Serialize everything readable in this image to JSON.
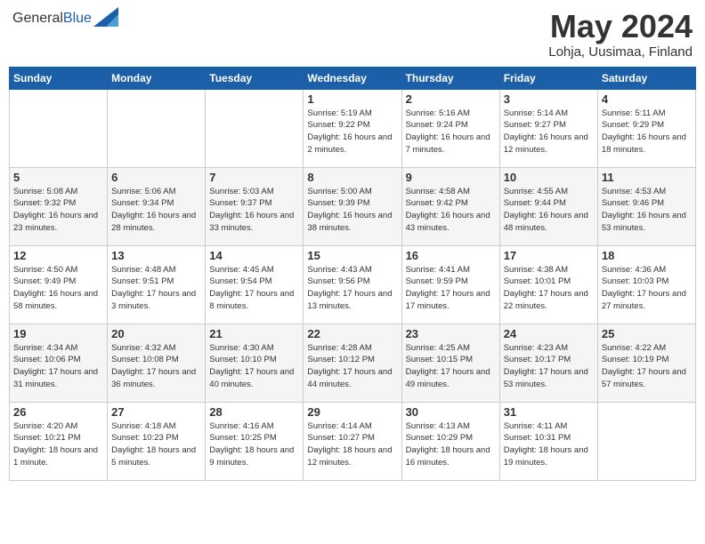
{
  "header": {
    "logo_general": "General",
    "logo_blue": "Blue",
    "month": "May 2024",
    "location": "Lohja, Uusimaa, Finland"
  },
  "days_of_week": [
    "Sunday",
    "Monday",
    "Tuesday",
    "Wednesday",
    "Thursday",
    "Friday",
    "Saturday"
  ],
  "weeks": [
    [
      {
        "day": "",
        "sunrise": "",
        "sunset": "",
        "daylight": ""
      },
      {
        "day": "",
        "sunrise": "",
        "sunset": "",
        "daylight": ""
      },
      {
        "day": "",
        "sunrise": "",
        "sunset": "",
        "daylight": ""
      },
      {
        "day": "1",
        "sunrise": "Sunrise: 5:19 AM",
        "sunset": "Sunset: 9:22 PM",
        "daylight": "Daylight: 16 hours and 2 minutes."
      },
      {
        "day": "2",
        "sunrise": "Sunrise: 5:16 AM",
        "sunset": "Sunset: 9:24 PM",
        "daylight": "Daylight: 16 hours and 7 minutes."
      },
      {
        "day": "3",
        "sunrise": "Sunrise: 5:14 AM",
        "sunset": "Sunset: 9:27 PM",
        "daylight": "Daylight: 16 hours and 12 minutes."
      },
      {
        "day": "4",
        "sunrise": "Sunrise: 5:11 AM",
        "sunset": "Sunset: 9:29 PM",
        "daylight": "Daylight: 16 hours and 18 minutes."
      }
    ],
    [
      {
        "day": "5",
        "sunrise": "Sunrise: 5:08 AM",
        "sunset": "Sunset: 9:32 PM",
        "daylight": "Daylight: 16 hours and 23 minutes."
      },
      {
        "day": "6",
        "sunrise": "Sunrise: 5:06 AM",
        "sunset": "Sunset: 9:34 PM",
        "daylight": "Daylight: 16 hours and 28 minutes."
      },
      {
        "day": "7",
        "sunrise": "Sunrise: 5:03 AM",
        "sunset": "Sunset: 9:37 PM",
        "daylight": "Daylight: 16 hours and 33 minutes."
      },
      {
        "day": "8",
        "sunrise": "Sunrise: 5:00 AM",
        "sunset": "Sunset: 9:39 PM",
        "daylight": "Daylight: 16 hours and 38 minutes."
      },
      {
        "day": "9",
        "sunrise": "Sunrise: 4:58 AM",
        "sunset": "Sunset: 9:42 PM",
        "daylight": "Daylight: 16 hours and 43 minutes."
      },
      {
        "day": "10",
        "sunrise": "Sunrise: 4:55 AM",
        "sunset": "Sunset: 9:44 PM",
        "daylight": "Daylight: 16 hours and 48 minutes."
      },
      {
        "day": "11",
        "sunrise": "Sunrise: 4:53 AM",
        "sunset": "Sunset: 9:46 PM",
        "daylight": "Daylight: 16 hours and 53 minutes."
      }
    ],
    [
      {
        "day": "12",
        "sunrise": "Sunrise: 4:50 AM",
        "sunset": "Sunset: 9:49 PM",
        "daylight": "Daylight: 16 hours and 58 minutes."
      },
      {
        "day": "13",
        "sunrise": "Sunrise: 4:48 AM",
        "sunset": "Sunset: 9:51 PM",
        "daylight": "Daylight: 17 hours and 3 minutes."
      },
      {
        "day": "14",
        "sunrise": "Sunrise: 4:45 AM",
        "sunset": "Sunset: 9:54 PM",
        "daylight": "Daylight: 17 hours and 8 minutes."
      },
      {
        "day": "15",
        "sunrise": "Sunrise: 4:43 AM",
        "sunset": "Sunset: 9:56 PM",
        "daylight": "Daylight: 17 hours and 13 minutes."
      },
      {
        "day": "16",
        "sunrise": "Sunrise: 4:41 AM",
        "sunset": "Sunset: 9:59 PM",
        "daylight": "Daylight: 17 hours and 17 minutes."
      },
      {
        "day": "17",
        "sunrise": "Sunrise: 4:38 AM",
        "sunset": "Sunset: 10:01 PM",
        "daylight": "Daylight: 17 hours and 22 minutes."
      },
      {
        "day": "18",
        "sunrise": "Sunrise: 4:36 AM",
        "sunset": "Sunset: 10:03 PM",
        "daylight": "Daylight: 17 hours and 27 minutes."
      }
    ],
    [
      {
        "day": "19",
        "sunrise": "Sunrise: 4:34 AM",
        "sunset": "Sunset: 10:06 PM",
        "daylight": "Daylight: 17 hours and 31 minutes."
      },
      {
        "day": "20",
        "sunrise": "Sunrise: 4:32 AM",
        "sunset": "Sunset: 10:08 PM",
        "daylight": "Daylight: 17 hours and 36 minutes."
      },
      {
        "day": "21",
        "sunrise": "Sunrise: 4:30 AM",
        "sunset": "Sunset: 10:10 PM",
        "daylight": "Daylight: 17 hours and 40 minutes."
      },
      {
        "day": "22",
        "sunrise": "Sunrise: 4:28 AM",
        "sunset": "Sunset: 10:12 PM",
        "daylight": "Daylight: 17 hours and 44 minutes."
      },
      {
        "day": "23",
        "sunrise": "Sunrise: 4:25 AM",
        "sunset": "Sunset: 10:15 PM",
        "daylight": "Daylight: 17 hours and 49 minutes."
      },
      {
        "day": "24",
        "sunrise": "Sunrise: 4:23 AM",
        "sunset": "Sunset: 10:17 PM",
        "daylight": "Daylight: 17 hours and 53 minutes."
      },
      {
        "day": "25",
        "sunrise": "Sunrise: 4:22 AM",
        "sunset": "Sunset: 10:19 PM",
        "daylight": "Daylight: 17 hours and 57 minutes."
      }
    ],
    [
      {
        "day": "26",
        "sunrise": "Sunrise: 4:20 AM",
        "sunset": "Sunset: 10:21 PM",
        "daylight": "Daylight: 18 hours and 1 minute."
      },
      {
        "day": "27",
        "sunrise": "Sunrise: 4:18 AM",
        "sunset": "Sunset: 10:23 PM",
        "daylight": "Daylight: 18 hours and 5 minutes."
      },
      {
        "day": "28",
        "sunrise": "Sunrise: 4:16 AM",
        "sunset": "Sunset: 10:25 PM",
        "daylight": "Daylight: 18 hours and 9 minutes."
      },
      {
        "day": "29",
        "sunrise": "Sunrise: 4:14 AM",
        "sunset": "Sunset: 10:27 PM",
        "daylight": "Daylight: 18 hours and 12 minutes."
      },
      {
        "day": "30",
        "sunrise": "Sunrise: 4:13 AM",
        "sunset": "Sunset: 10:29 PM",
        "daylight": "Daylight: 18 hours and 16 minutes."
      },
      {
        "day": "31",
        "sunrise": "Sunrise: 4:11 AM",
        "sunset": "Sunset: 10:31 PM",
        "daylight": "Daylight: 18 hours and 19 minutes."
      },
      {
        "day": "",
        "sunrise": "",
        "sunset": "",
        "daylight": ""
      }
    ]
  ]
}
